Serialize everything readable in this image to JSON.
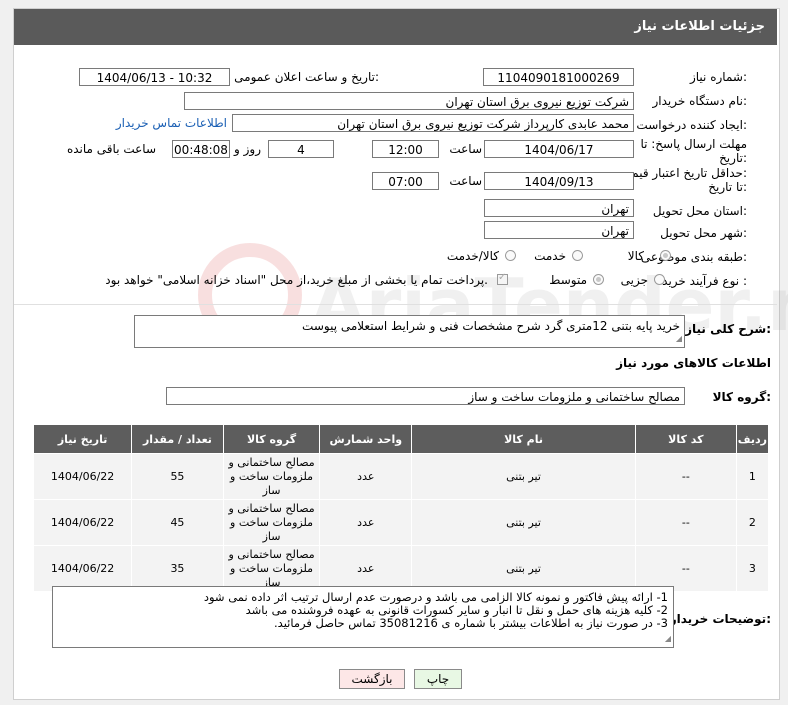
{
  "header": {
    "title": "جزئیات اطلاعات نیاز"
  },
  "form": {
    "need_number": {
      "label": "شماره نیاز:",
      "value": "1104090181000269"
    },
    "announce": {
      "label": "تاریخ و ساعت اعلان عمومی:",
      "value": "1404/06/13 - 10:32"
    },
    "buyer_org": {
      "label": "نام دستگاه خریدار:",
      "value": "شرکت توزیع نیروی برق استان تهران"
    },
    "requester": {
      "label": "ایجاد کننده درخواست:",
      "value": "محمد عابدی کارپرداز شرکت توزیع نیروی برق استان تهران",
      "contact_link": "اطلاعات تماس خریدار"
    },
    "deadline": {
      "label_line1": "مهلت ارسال پاسخ: تا",
      "label_line2": "تاریخ:",
      "date": "1404/06/17",
      "time_label": "ساعت",
      "time": "12:00",
      "days": "4",
      "days_label": "روز و",
      "remaining": "00:48:08",
      "remaining_label": "ساعت باقی مانده"
    },
    "price_validity": {
      "label_line1": "حداقل تاریخ اعتبار قیمت:",
      "label_line2": "تا تاریخ:",
      "date": "1404/09/13",
      "time_label": "ساعت",
      "time": "07:00"
    },
    "province": {
      "label": "استان محل تحویل:",
      "value": "تهران"
    },
    "city": {
      "label": "شهر محل تحویل:",
      "value": "تهران"
    },
    "category": {
      "label": "طبقه بندی موضوعی:",
      "options": [
        "کالا",
        "خدمت",
        "کالا/خدمت"
      ],
      "selected": "کالا"
    },
    "process": {
      "label": "نوع فرآیند خرید :",
      "options": [
        "جزیی",
        "متوسط"
      ],
      "selected": "متوسط",
      "payment_note": "پرداخت تمام یا بخشی از مبلغ خرید،از محل \"اسناد خزانه اسلامی\" خواهد بود."
    },
    "description": {
      "label": "شرح کلی نیاز:",
      "value": "خرید پایه بتنی 12متری گرد شرح مشخصات فنی و شرایط استعلامی پیوست"
    }
  },
  "goods": {
    "section_title": "اطلاعات کالاهای مورد نیاز",
    "group_label": "گروه کالا:",
    "group_value": "مصالح ساختمانی و ملزومات ساخت و ساز",
    "columns": [
      "ردیف",
      "کد کالا",
      "نام کالا",
      "واحد شمارش",
      "گروه کالا",
      "تعداد / مقدار",
      "تاریخ نیاز"
    ],
    "rows": [
      {
        "row": "1",
        "code": "--",
        "name": "تیر بتنی",
        "unit": "عدد",
        "group": "مصالح ساختمانی و ملزومات ساخت و ساز",
        "qty": "55",
        "date": "1404/06/22"
      },
      {
        "row": "2",
        "code": "--",
        "name": "تیر بتنی",
        "unit": "عدد",
        "group": "مصالح ساختمانی و ملزومات ساخت و ساز",
        "qty": "45",
        "date": "1404/06/22"
      },
      {
        "row": "3",
        "code": "--",
        "name": "تیر بتنی",
        "unit": "عدد",
        "group": "مصالح ساختمانی و ملزومات ساخت و ساز",
        "qty": "35",
        "date": "1404/06/22"
      }
    ]
  },
  "buyer_notes": {
    "label": "توضیحات خریدار:",
    "lines": [
      "1- ارائه پیش فاکتور و نمونه کالا الزامی می باشد و درصورت عدم ارسال ترتیب اثر داده نمی شود",
      "2- کلیه هزینه های حمل و نقل تا انبار و سایر کسورات قانونی به عهده فروشنده می باشد",
      "3- در صورت نیاز به اطلاعات بیشتر با شماره ی 35081216 تماس حاصل فرمائید."
    ]
  },
  "buttons": {
    "print": "چاپ",
    "back": "بازگشت"
  },
  "watermark": {
    "text": "AriaTender.net"
  },
  "colors": {
    "header_bg": "#5a5a5a",
    "table_header_bg": "#5d5d5d",
    "link": "#1a5fb4",
    "back_button_bg": "#fde7e7",
    "print_button_bg": "#e8f8e4"
  }
}
